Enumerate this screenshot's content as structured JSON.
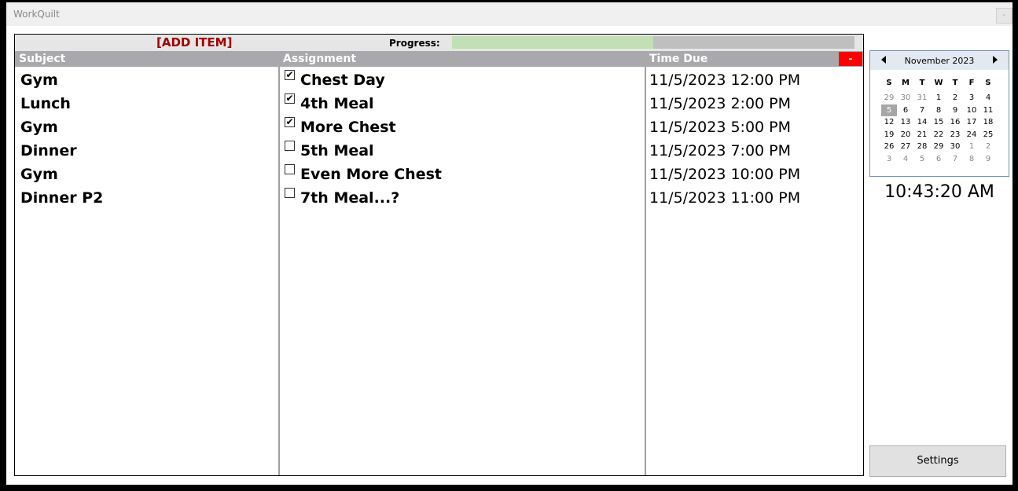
{
  "window": {
    "title": "WorkQuilt",
    "minimize_label": "-"
  },
  "toolbar": {
    "add_item_label": "[ADD ITEM]",
    "progress_label": "Progress:",
    "progress_fraction": 0.5
  },
  "columns": {
    "subject": "Subject",
    "assignment": "Assignment",
    "time_due": "Time Due"
  },
  "delete_label": "-",
  "rows": [
    {
      "subject": "Gym",
      "assignment": "Chest Day",
      "done": true,
      "time": "11/5/2023 12:00 PM"
    },
    {
      "subject": "Lunch",
      "assignment": "4th Meal",
      "done": true,
      "time": "11/5/2023 2:00 PM"
    },
    {
      "subject": "Gym",
      "assignment": "More Chest",
      "done": true,
      "time": "11/5/2023 5:00 PM"
    },
    {
      "subject": "Dinner",
      "assignment": "5th Meal",
      "done": false,
      "time": "11/5/2023 7:00 PM"
    },
    {
      "subject": "Gym",
      "assignment": "Even More Chest",
      "done": false,
      "time": "11/5/2023 10:00 PM"
    },
    {
      "subject": "Dinner P2",
      "assignment": "7th Meal...?",
      "done": false,
      "time": "11/5/2023 11:00 PM"
    }
  ],
  "calendar": {
    "month_label": "November 2023",
    "weekdays": [
      "S",
      "M",
      "T",
      "W",
      "T",
      "F",
      "S"
    ],
    "weeks": [
      [
        {
          "d": "29",
          "dim": true
        },
        {
          "d": "30",
          "dim": true
        },
        {
          "d": "31",
          "dim": true
        },
        {
          "d": "1"
        },
        {
          "d": "2"
        },
        {
          "d": "3"
        },
        {
          "d": "4"
        }
      ],
      [
        {
          "d": "5",
          "sel": true
        },
        {
          "d": "6"
        },
        {
          "d": "7"
        },
        {
          "d": "8"
        },
        {
          "d": "9"
        },
        {
          "d": "10"
        },
        {
          "d": "11"
        }
      ],
      [
        {
          "d": "12"
        },
        {
          "d": "13"
        },
        {
          "d": "14"
        },
        {
          "d": "15"
        },
        {
          "d": "16"
        },
        {
          "d": "17"
        },
        {
          "d": "18"
        }
      ],
      [
        {
          "d": "19"
        },
        {
          "d": "20"
        },
        {
          "d": "21"
        },
        {
          "d": "22"
        },
        {
          "d": "23"
        },
        {
          "d": "24"
        },
        {
          "d": "25"
        }
      ],
      [
        {
          "d": "26"
        },
        {
          "d": "27"
        },
        {
          "d": "28"
        },
        {
          "d": "29"
        },
        {
          "d": "30"
        },
        {
          "d": "1",
          "dim": true
        },
        {
          "d": "2",
          "dim": true
        }
      ],
      [
        {
          "d": "3",
          "dim": true
        },
        {
          "d": "4",
          "dim": true
        },
        {
          "d": "5",
          "dim": true
        },
        {
          "d": "6",
          "dim": true
        },
        {
          "d": "7",
          "dim": true
        },
        {
          "d": "8",
          "dim": true
        },
        {
          "d": "9",
          "dim": true
        }
      ]
    ]
  },
  "clock": "10:43:20 AM",
  "settings_label": "Settings",
  "colors": {
    "accent_red": "#a00000",
    "progress_fill": "#c2dfb6",
    "header_gray": "#a8a8ad",
    "delete_red": "#ff0000"
  }
}
